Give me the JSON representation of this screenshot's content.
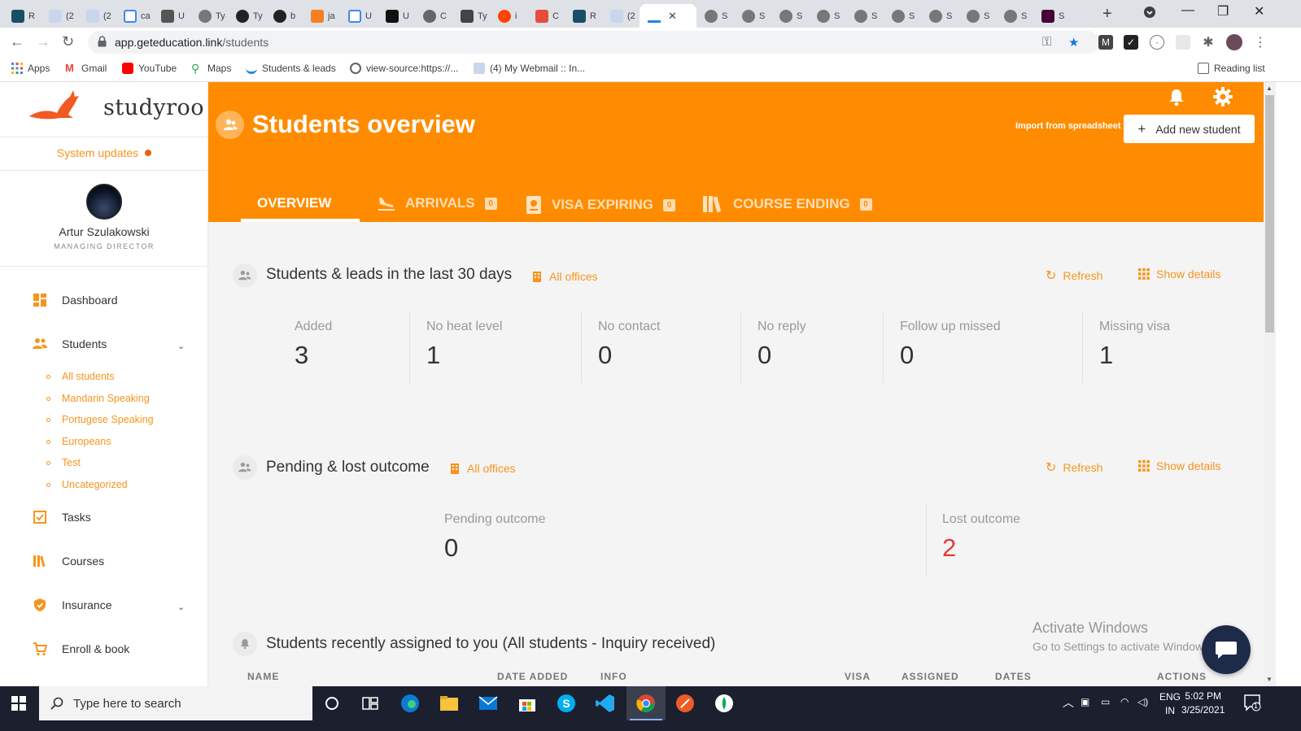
{
  "browser": {
    "tabs_left": [
      "R",
      "(2",
      "(2",
      "ca",
      "U",
      "Ty",
      "Ty",
      "b",
      "ja",
      "U",
      "U",
      "C",
      "Ty",
      "i",
      "C",
      "R",
      "(2"
    ],
    "tabs_right": [
      "S",
      "S",
      "S",
      "S",
      "S",
      "S",
      "S",
      "S",
      "S"
    ],
    "last_tab": "S",
    "url_host": "app.geteducation.link",
    "url_path": "/students",
    "bookmarks": [
      "Apps",
      "Gmail",
      "YouTube",
      "Maps",
      "Students & leads",
      "view-source:https://...",
      "(4) My Webmail :: In..."
    ],
    "reading_list": "Reading list"
  },
  "sidebar": {
    "logo_text": "studyroo",
    "system_updates": "System updates",
    "user_name": "Artur Szulakowski",
    "user_role": "MANAGING DIRECTOR",
    "nav": {
      "dashboard": "Dashboard",
      "students": "Students",
      "tasks": "Tasks",
      "courses": "Courses",
      "insurance": "Insurance",
      "enroll": "Enroll & book"
    },
    "student_groups": [
      "All students",
      "Mandarin Speaking",
      "Portugese Speaking",
      "Europeans",
      "Test",
      "Uncategorized"
    ]
  },
  "header": {
    "title": "Students overview",
    "import_link": "Import from spreadsheet",
    "add_button": "Add new student",
    "tabs": [
      {
        "label": "OVERVIEW",
        "badge": ""
      },
      {
        "label": "ARRIVALS",
        "badge": "0"
      },
      {
        "label": "VISA EXPIRING",
        "badge": "0"
      },
      {
        "label": "COURSE ENDING",
        "badge": "0"
      }
    ]
  },
  "section1": {
    "title": "Students & leads in the last 30 days",
    "filter": "All offices",
    "refresh": "Refresh",
    "details": "Show details",
    "stats": [
      {
        "label": "Added",
        "value": "3"
      },
      {
        "label": "No heat level",
        "value": "1"
      },
      {
        "label": "No contact",
        "value": "0"
      },
      {
        "label": "No reply",
        "value": "0"
      },
      {
        "label": "Follow up missed",
        "value": "0"
      },
      {
        "label": "Missing visa",
        "value": "1"
      }
    ]
  },
  "section2": {
    "title": "Pending & lost outcome",
    "filter": "All offices",
    "refresh": "Refresh",
    "details": "Show details",
    "stats": [
      {
        "label": "Pending outcome",
        "value": "0"
      },
      {
        "label": "Lost outcome",
        "value": "2"
      }
    ]
  },
  "section3": {
    "title": "Students recently assigned to you (All students - Inquiry received)",
    "columns": [
      "NAME",
      "DATE ADDED",
      "INFO",
      "VISA",
      "ASSIGNED",
      "DATES",
      "ACTIONS"
    ]
  },
  "watermark": {
    "line1": "Activate Windows",
    "line2": "Go to Settings to activate Windows."
  },
  "taskbar": {
    "search_placeholder": "Type here to search",
    "lang1": "ENG",
    "lang2": "IN",
    "time": "5:02 PM",
    "date": "3/25/2021",
    "notif_count": "1"
  },
  "colors": {
    "brand_orange": "#ff8c00",
    "accent_orange": "#f7941d",
    "alert_red": "#e53935"
  }
}
